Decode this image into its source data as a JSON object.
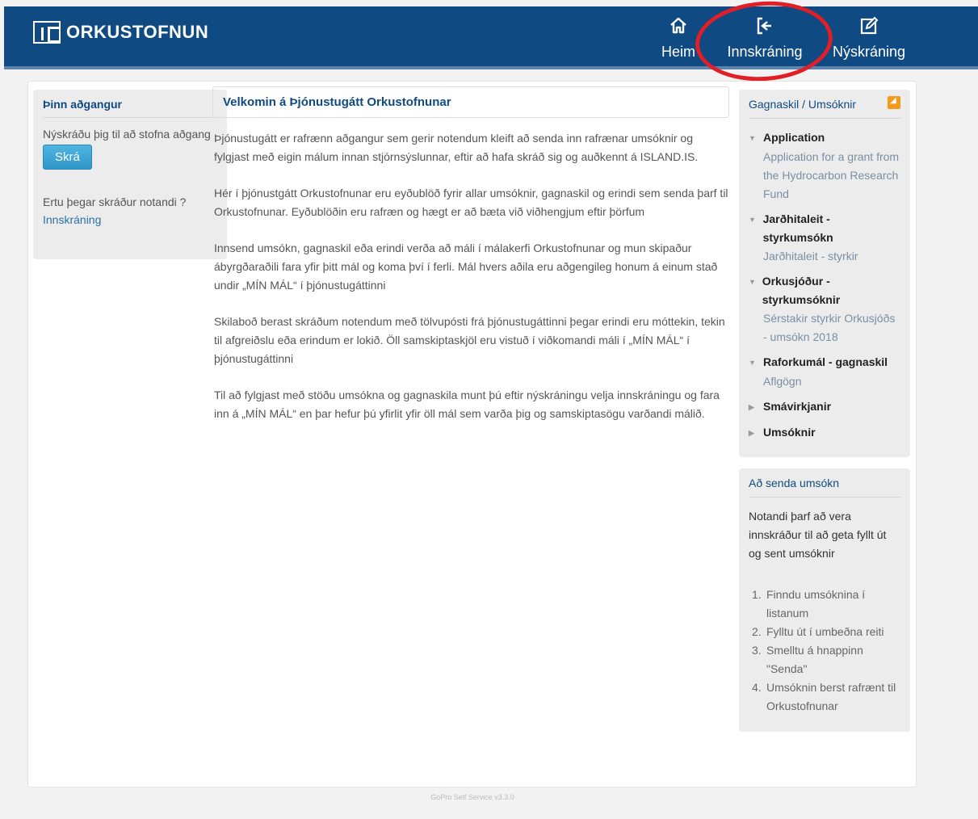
{
  "header": {
    "logo_text": "ORKUSTOFNUN",
    "nav": {
      "home_label": "Heim",
      "login_label": "Innskráning",
      "signup_label": "Nýskráning"
    }
  },
  "left": {
    "title": "Þinn aðgangur",
    "text": "Nýskráðu þig til að stofna aðgang",
    "button": "Skrá",
    "question": "Ertu þegar skráður notandi ?",
    "link": "Innskráning"
  },
  "main": {
    "title": "Velkomin á Þjónustugátt Orkustofnunar",
    "paragraphs": [
      "Þjónustugátt er rafrænn aðgangur sem gerir notendum kleift að senda inn rafrænar umsóknir og fylgjast með eigin málum innan stjórnsýslunnar, eftir að hafa skráð sig og auðkennt á ISLAND.IS.",
      "Hér í þjónustgátt Orkustofnunar eru eyðublöð fyrir allar umsóknir, gagnaskil og erindi sem senda þarf til Orkustofnunar. Eyðublöðin eru rafræn og hægt er að bæta við viðhengjum eftir þörfum",
      "Innsend umsókn, gagnaskil eða erindi verða að máli í málakerfi Orkustofnunar og mun skipaður ábyrgðaraðili fara yfir þitt mál og koma því í ferli. Mál hvers aðila eru aðgengileg honum á einum stað undir „MÍN MÁL“ í þjónustugáttinni",
      "Skilaboð berast skráðum notendum með tölvupósti frá þjónustugáttinni þegar erindi eru móttekin, tekin til afgreiðslu eða erindum er lokið. Öll samskiptaskjöl eru vistuð í viðkomandi máli í „MÍN MÁL“ í þjónustugáttinni",
      "Til að fylgjast með stöðu umsókna og gagnaskila munt þú eftir nýskráningu velja innskráningu og fara inn á „MÍN MÁL“ en þar hefur þú yfirlit yfir öll mál sem varða þig og samskiptasögu varðandi málið."
    ]
  },
  "sidebar": {
    "title": "Gagnaskil / Umsóknir",
    "categories": [
      {
        "arrow": "▼",
        "label": "Application",
        "sub": "Application for a grant from the Hydrocarbon Research Fund"
      },
      {
        "arrow": "▼",
        "label": "Jarðhitaleit - styrkumsókn",
        "sub": "Jarðhitaleit - styrkir"
      },
      {
        "arrow": "▼",
        "label": "Orkusjóður - styrkumsóknir",
        "sub": "Sérstakir styrkir Orkusjóðs - umsókn 2018"
      },
      {
        "arrow": "▼",
        "label": "Raforkumál - gagnaskil",
        "sub": "Aflgögn"
      },
      {
        "arrow": "▶",
        "label": "Smávirkjanir",
        "sub": ""
      },
      {
        "arrow": "▶",
        "label": "Umsóknir",
        "sub": ""
      }
    ],
    "send": {
      "title": "Að senda umsókn",
      "text": "Notandi þarf að vera innskráður til að geta fyllt út og sent umsóknir",
      "steps": [
        {
          "num": "1.",
          "text": "Finndu umsóknina í listanum"
        },
        {
          "num": "2.",
          "text": "Fylltu út í umbeðna reiti"
        },
        {
          "num": "3.",
          "text": "Smelltu á hnappinn \"Senda\""
        },
        {
          "num": "4.",
          "text": "Umsóknin berst rafrænt til Orkustofnunar"
        }
      ]
    }
  },
  "footer": {
    "text": "GoPro Self Service v3.3.0"
  },
  "colors": {
    "header": "#0f4a82",
    "highlight_circle": "#e01f26",
    "button": "#37a4d6"
  },
  "icons": {
    "home": "home-icon",
    "login": "login-icon",
    "signup": "edit-icon",
    "rss": "rss-icon"
  }
}
